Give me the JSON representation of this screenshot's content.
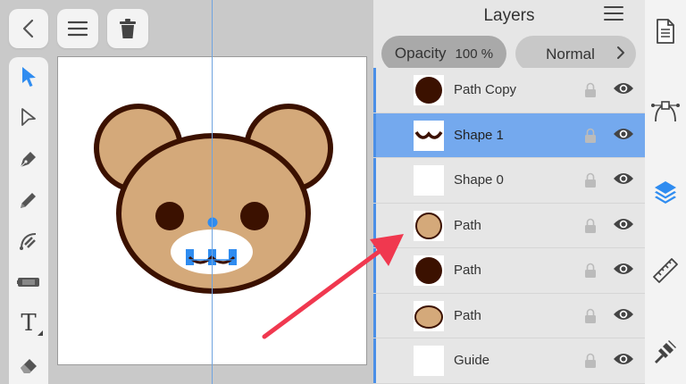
{
  "layers_panel": {
    "title": "Layers",
    "opacity_label": "Opacity",
    "opacity_value": "100 %",
    "blend_mode": "Normal",
    "layers": [
      {
        "name": "Path Copy",
        "thumb": "dark-circle",
        "selected": false
      },
      {
        "name": "Shape 1",
        "thumb": "mouth",
        "selected": true
      },
      {
        "name": "Shape 0",
        "thumb": "blank",
        "selected": false
      },
      {
        "name": "Path",
        "thumb": "tan-circle",
        "selected": false
      },
      {
        "name": "Path",
        "thumb": "dark-circle",
        "selected": false
      },
      {
        "name": "Path",
        "thumb": "tan-ellipse",
        "selected": false
      },
      {
        "name": "Guide",
        "thumb": "blank",
        "selected": false
      }
    ]
  },
  "toolbar": {
    "top_buttons": [
      "back-icon",
      "menu-icon",
      "trash-icon"
    ],
    "tools": [
      "select-arrow-icon",
      "direct-select-icon",
      "pen-icon",
      "pencil-icon",
      "node-icon",
      "ruler-tool-icon",
      "text-tool-icon",
      "eraser-icon"
    ],
    "text_tool_glyph": "T"
  },
  "sidebar": {
    "items": [
      "document-icon",
      "bezier-icon",
      "layers-icon",
      "ruler-icon",
      "brush-icon"
    ]
  },
  "colors": {
    "accent": "#2f8cf0",
    "selected_row": "#74a9ee",
    "bear_fill": "#d4a97a",
    "bear_outline": "#3b1100"
  }
}
